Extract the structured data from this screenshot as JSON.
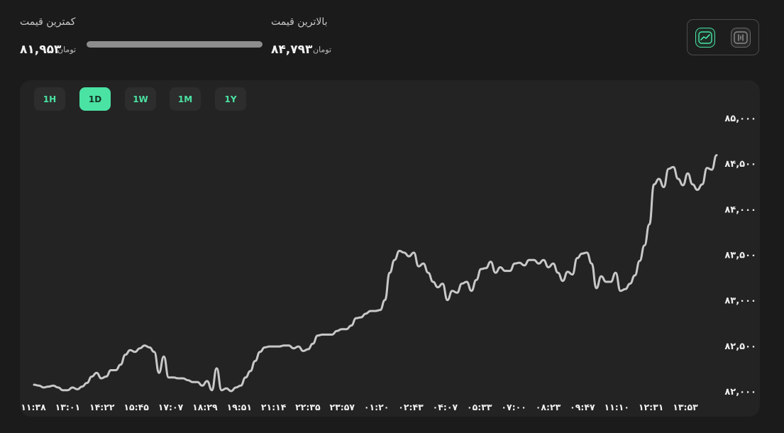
{
  "stats": {
    "low": {
      "label": "کمترین قیمت",
      "value": "۸۱,۹۵۳",
      "unit": "تومان"
    },
    "high": {
      "label": "بالاترین قیمت",
      "value": "۸۴,۷۹۳",
      "unit": "تومان"
    },
    "range_fill_fraction": 1.0
  },
  "view_toggle": {
    "selected": "line",
    "icons": [
      "line-chart-icon",
      "candlestick-icon"
    ]
  },
  "periods": [
    {
      "label": "1H",
      "active": false
    },
    {
      "label": "1D",
      "active": true
    },
    {
      "label": "1W",
      "active": false
    },
    {
      "label": "1M",
      "active": false
    },
    {
      "label": "1Y",
      "active": false
    }
  ],
  "colors": {
    "accent": "#4ae3a3",
    "line": "#c8c8c8",
    "background": "#1b1b1b",
    "panel": "#232323"
  },
  "chart_data": {
    "type": "line",
    "title": "",
    "xlabel": "",
    "ylabel": "",
    "ylim": [
      82000,
      85000
    ],
    "y_ticks": [
      {
        "value": 85000,
        "label": "۸۵,۰۰۰"
      },
      {
        "value": 84500,
        "label": "۸۴,۵۰۰"
      },
      {
        "value": 84000,
        "label": "۸۴,۰۰۰"
      },
      {
        "value": 83500,
        "label": "۸۳,۵۰۰"
      },
      {
        "value": 83000,
        "label": "۸۳,۰۰۰"
      },
      {
        "value": 82500,
        "label": "۸۲,۵۰۰"
      },
      {
        "value": 82000,
        "label": "۸۲,۰۰۰"
      }
    ],
    "x_ticks": [
      "۱۱:۳۸",
      "۱۳:۰۱",
      "۱۴:۲۲",
      "۱۵:۴۵",
      "۱۷:۰۷",
      "۱۸:۲۹",
      "۱۹:۵۱",
      "۲۱:۱۴",
      "۲۲:۳۵",
      "۲۳:۵۷",
      "۰۱:۲۰",
      "۰۲:۴۳",
      "۰۴:۰۷",
      "۰۵:۳۳",
      "۰۷:۰۰",
      "۰۸:۲۳",
      "۰۹:۴۷",
      "۱۱:۱۰",
      "۱۲:۳۱",
      "۱۳:۵۳"
    ],
    "grid": false,
    "legend": "none",
    "series": [
      {
        "values": [
          82070,
          82060,
          82040,
          82050,
          82060,
          82040,
          82010,
          82010,
          82040,
          82020,
          82050,
          82090,
          82160,
          82200,
          82140,
          82160,
          82230,
          82230,
          82290,
          82400,
          82450,
          82430,
          82470,
          82500,
          82480,
          82430,
          82200,
          82380,
          82150,
          82150,
          82140,
          82140,
          82120,
          82100,
          82100,
          82060,
          82110,
          82010,
          82250,
          82010,
          82030,
          82000,
          82040,
          82060,
          82150,
          82220,
          82330,
          82430,
          82480,
          82490,
          82490,
          82490,
          82500,
          82500,
          82470,
          82490,
          82440,
          82460,
          82520,
          82610,
          82620,
          82620,
          82620,
          82660,
          82680,
          82680,
          82720,
          82800,
          82810,
          82850,
          82880,
          82880,
          82890,
          83000,
          83300,
          83440,
          83540,
          83520,
          83480,
          83520,
          83370,
          83400,
          83300,
          83200,
          83140,
          83180,
          83000,
          83100,
          83080,
          83180,
          83200,
          83100,
          83220,
          83340,
          83350,
          83420,
          83300,
          83360,
          83320,
          83320,
          83400,
          83410,
          83380,
          83440,
          83440,
          83400,
          83440,
          83360,
          83400,
          83300,
          83210,
          83310,
          83280,
          83460,
          83510,
          83520,
          83400,
          83130,
          83260,
          83200,
          83200,
          83300,
          83100,
          83120,
          83180,
          83270,
          83430,
          83600,
          83830,
          84270,
          84330,
          84240,
          84440,
          84460,
          84330,
          84260,
          84390,
          84270,
          84210,
          84270,
          84450,
          84430,
          84590
        ]
      }
    ]
  }
}
